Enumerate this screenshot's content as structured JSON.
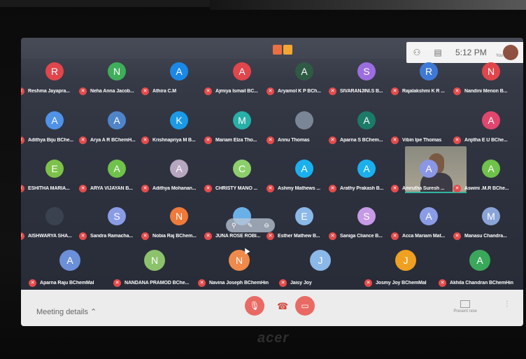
{
  "colors": {
    "accent": "#e54a4a",
    "bottombar": "#ececec",
    "screen": "#2f3340"
  },
  "topbar": {
    "time": "5:12 PM",
    "you_label": "You",
    "participants_icon": "people-icon",
    "chat_icon": "chat-icon"
  },
  "participants": [
    {
      "initial": "R",
      "name": "Reshma Jayapra...",
      "color": "#e0464b"
    },
    {
      "initial": "N",
      "name": "Neha Anna Jacob...",
      "color": "#3fae5a"
    },
    {
      "initial": "A",
      "name": "Athira C.M",
      "color": "#1a88e6"
    },
    {
      "initial": "A",
      "name": "Ajmiya Ismail BC...",
      "color": "#e0464b"
    },
    {
      "initial": "A",
      "name": "Aryamol K P BCh...",
      "color": "#2f5a44"
    },
    {
      "initial": "S",
      "name": "SIVARANJINI.S B...",
      "color": "#9c6de0"
    },
    {
      "initial": "R",
      "name": "Rajalakshmi K R ...",
      "color": "#3e79d8"
    },
    {
      "initial": "N",
      "name": "Nandini Menon B...",
      "color": "#e0464b"
    },
    {
      "initial": "A",
      "name": "Adithya Biju BChe...",
      "color": "#4f92e8"
    },
    {
      "initial": "A",
      "name": "Arya A R BChemH...",
      "color": "#4f84c8"
    },
    {
      "initial": "K",
      "name": "Krishnapriya M B...",
      "color": "#1a9ae6"
    },
    {
      "initial": "M",
      "name": "Mariam Elza Tho...",
      "color": "#26b0a8"
    },
    {
      "initial": "",
      "name": "Annu Thomas",
      "color": "#7a8696"
    },
    {
      "initial": "A",
      "name": "Aparna S BChem...",
      "color": "#1c7a68"
    },
    {
      "initial": "",
      "name": "Vibin Ipe Thomas",
      "color": "#000000"
    },
    {
      "initial": "A",
      "name": "Anjitha E U BChe...",
      "color": "#e0466e"
    },
    {
      "initial": "E",
      "name": "ESHITHA MARIA...",
      "color": "#7cc24a"
    },
    {
      "initial": "A",
      "name": "ARYA VIJAYAN B...",
      "color": "#6fc24a"
    },
    {
      "initial": "A",
      "name": "Adithya Mohanan...",
      "color": "#b7a6c0"
    },
    {
      "initial": "C",
      "name": "CHRISTY MANO ...",
      "color": "#8ccf6b"
    },
    {
      "initial": "A",
      "name": "Ashmy Mathews ...",
      "color": "#1ab0ee"
    },
    {
      "initial": "A",
      "name": "Arathy Prakash B...",
      "color": "#1ab0ee"
    },
    {
      "initial": "A",
      "name": "Amrutha Suresh ...",
      "color": "#8a96e6"
    },
    {
      "initial": "A",
      "name": "Aswini .M.R BChe...",
      "color": "#6fc24a"
    },
    {
      "initial": "",
      "name": "AISHWARYA SHA...",
      "color": "#3a4250"
    },
    {
      "initial": "S",
      "name": "Sandra Ramacha...",
      "color": "#8a9ce6"
    },
    {
      "initial": "N",
      "name": "Nobia Raj BChem...",
      "color": "#f07a3a"
    },
    {
      "initial": "",
      "name": "JUNA ROSE ROBI...",
      "color": "#6ab0e8"
    },
    {
      "initial": "E",
      "name": "Esther Mathew B...",
      "color": "#8ab8e8"
    },
    {
      "initial": "S",
      "name": "Saniga Cliance B...",
      "color": "#c69ae6"
    },
    {
      "initial": "A",
      "name": "Acca Mariam Mat...",
      "color": "#8a9ce6"
    },
    {
      "initial": "M",
      "name": "Manasu Chandra...",
      "color": "#8aa4d8"
    },
    {
      "initial": "A",
      "name": "Aparna Raju BChemMal",
      "color": "#6b8fd8"
    },
    {
      "initial": "N",
      "name": "NANDANA PRAMOD BChe...",
      "color": "#8cc26b"
    },
    {
      "initial": "N",
      "name": "Navina Joseph BChemHin",
      "color": "#f08a4a"
    },
    {
      "initial": "J",
      "name": "Jaisy Joy",
      "color": "#8ab8e8"
    },
    {
      "initial": "J",
      "name": "Josmy Joy BChemMal",
      "color": "#f0a020"
    },
    {
      "initial": "A",
      "name": "Akhila Chandran BChemHin",
      "color": "#3aa85a"
    }
  ],
  "bottombar": {
    "meeting_details": "Meeting details",
    "present_now": "Present now"
  },
  "brand": "acer"
}
